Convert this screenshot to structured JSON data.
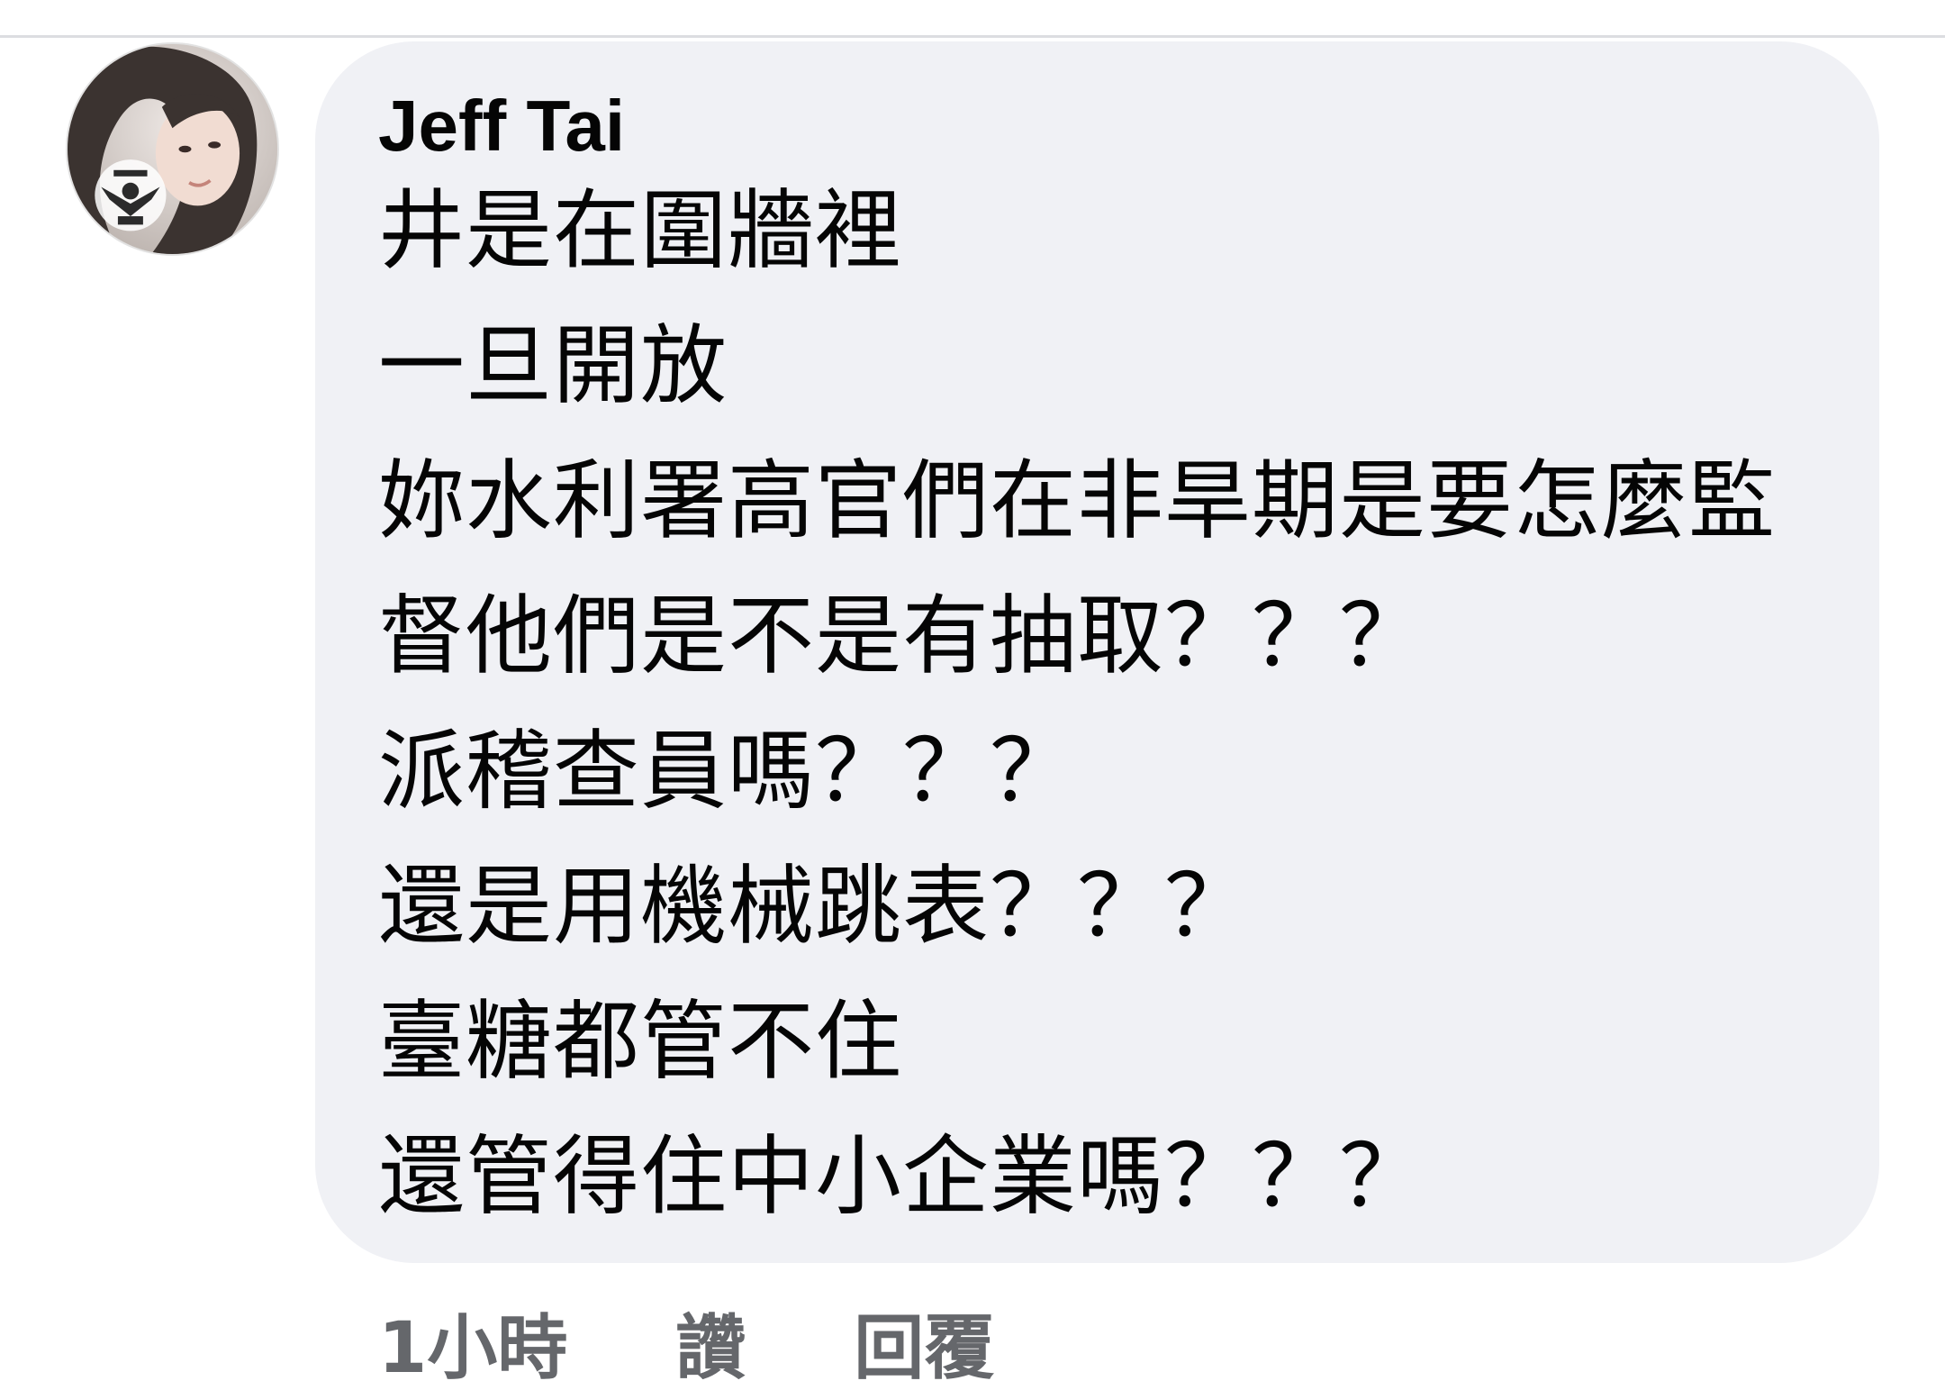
{
  "comment": {
    "author": "Jeff Tai",
    "avatar_icon": "user-avatar-photo",
    "lines": [
      "井是在圍牆裡",
      "一旦開放",
      "妳水利署高官們在非旱期是要怎麼監",
      "督他們是不是有抽取？？？",
      "派稽查員嗎？？？",
      "還是用機械跳表？？？",
      "臺糖都管不住",
      "還管得住中小企業嗎？？？"
    ]
  },
  "actions": {
    "timestamp": "1小時",
    "like_label": "讚",
    "reply_label": "回覆"
  },
  "colors": {
    "bubble_background": "#f0f1f5",
    "text": "#050505",
    "secondary_text": "#65676b",
    "divider": "#dcdde1"
  }
}
